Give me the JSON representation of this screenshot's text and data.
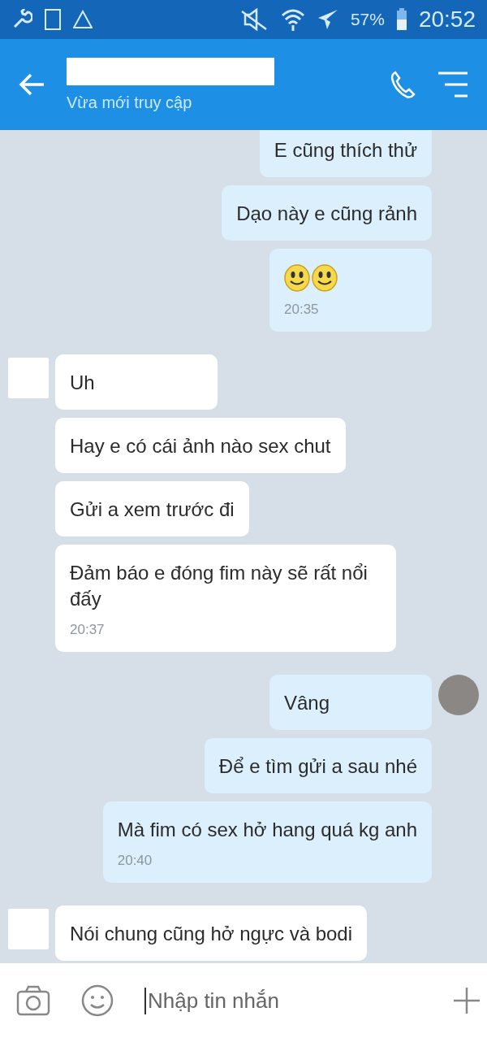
{
  "status_bar": {
    "battery": "57%",
    "time": "20:52"
  },
  "header": {
    "subtitle": "Vừa mới truy cập"
  },
  "groups": [
    {
      "outgoing": true,
      "avatar": false,
      "messages": [
        {
          "kind": "text",
          "text": "E cũng thích thử"
        },
        {
          "kind": "text",
          "text": "Dạo này e cũng rảnh"
        },
        {
          "kind": "emoji",
          "time": "20:35"
        }
      ]
    },
    {
      "outgoing": false,
      "avatar": true,
      "messages": [
        {
          "kind": "text",
          "text": "Uh"
        },
        {
          "kind": "text",
          "text": "Hay e có cái ảnh nào sex chut"
        },
        {
          "kind": "text",
          "text": "Gửi a xem trước đi"
        },
        {
          "kind": "text",
          "text": "Đảm báo e đóng fim này sẽ rất nổi đấy",
          "time": "20:37"
        }
      ]
    },
    {
      "outgoing": true,
      "avatar": true,
      "messages": [
        {
          "kind": "text",
          "text": "Vâng"
        },
        {
          "kind": "text",
          "text": "Để e tìm gửi a sau nhé"
        },
        {
          "kind": "text",
          "text": "Mà fim có sex hở hang quá kg anh",
          "time": "20:40"
        }
      ]
    },
    {
      "outgoing": false,
      "avatar": true,
      "messages": [
        {
          "kind": "text",
          "text": "Nói chung cũng hở ngực và bodi"
        }
      ]
    }
  ],
  "composer": {
    "placeholder": "Nhập tin nhắn"
  }
}
